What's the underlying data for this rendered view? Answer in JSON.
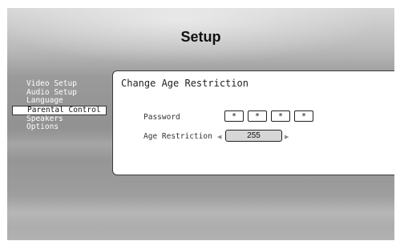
{
  "header": {
    "title": "Setup"
  },
  "menu": {
    "items": [
      {
        "label": "Video Setup",
        "selected": false
      },
      {
        "label": "Audio Setup",
        "selected": false
      },
      {
        "label": "Language",
        "selected": false
      },
      {
        "label": "Parental Control",
        "selected": true
      },
      {
        "label": "Speakers",
        "selected": false
      },
      {
        "label": "Options",
        "selected": false
      }
    ]
  },
  "panel": {
    "title": "Change Age Restriction",
    "password_label": "Password",
    "password_mask": [
      "*",
      "*",
      "*",
      "*"
    ],
    "age_label": "Age Restriction",
    "age_value": "255",
    "arrow_left": "◀",
    "arrow_right": "▶"
  }
}
